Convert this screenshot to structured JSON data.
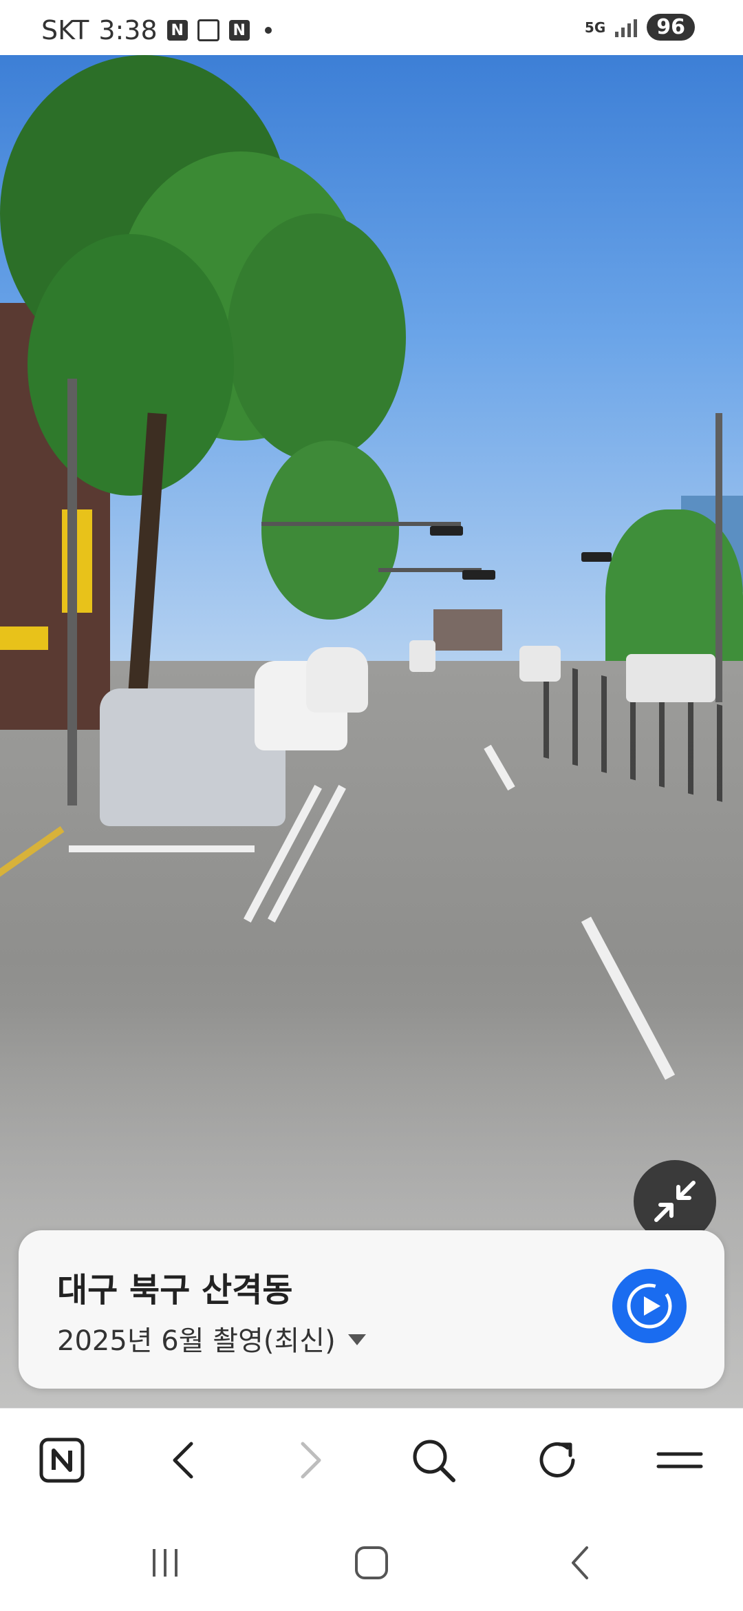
{
  "status_bar": {
    "carrier": "SKT",
    "time": "3:38",
    "notification_icons": [
      "naver-icon",
      "screenshot-icon",
      "naver-icon"
    ],
    "network": "5G",
    "battery": "96"
  },
  "street_view": {
    "collapse_icon": "collapse-arrows-icon"
  },
  "info_card": {
    "location": "대구 북구 산격동",
    "capture_date": "2025년 6월 촬영(최신)",
    "play_icon": "play-icon",
    "accent_color": "#1a6cf0"
  },
  "toolbar": {
    "buttons": [
      "naver-home-icon",
      "back-icon",
      "forward-icon",
      "search-icon",
      "refresh-icon",
      "menu-icon"
    ]
  },
  "nav_bar": {
    "buttons": [
      "recent-apps-icon",
      "home-icon",
      "back-icon"
    ]
  }
}
